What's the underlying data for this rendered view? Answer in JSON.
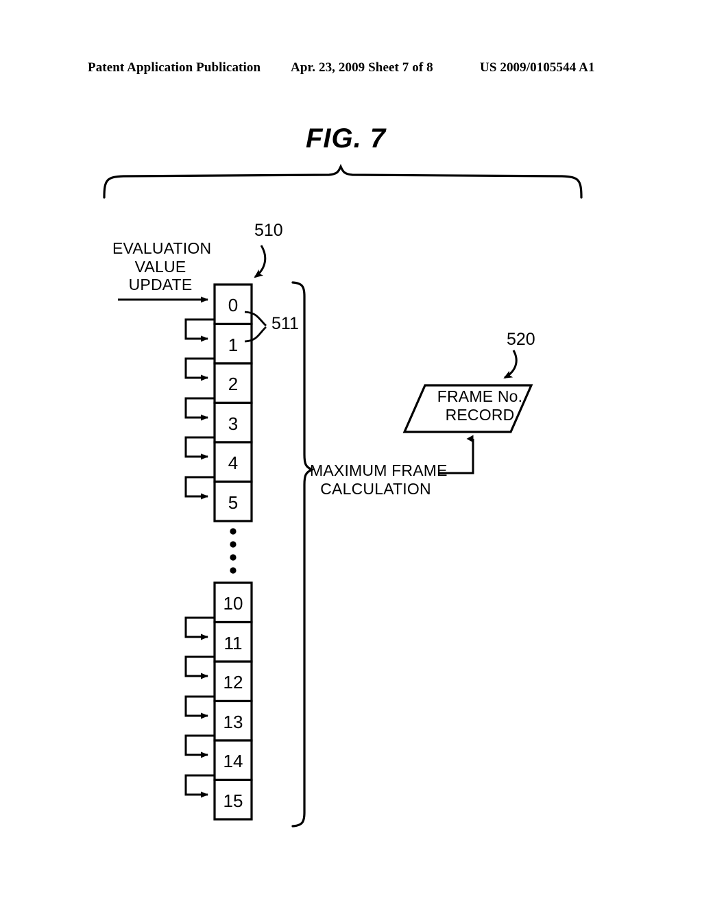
{
  "header": {
    "publication": "Patent Application Publication",
    "date_sheet": "Apr. 23, 2009  Sheet 7 of 8",
    "patent_number": "US 2009/0105544 A1"
  },
  "figure": {
    "title": "FIG. 7",
    "input_label": "EVALUATION\nVALUE\nUPDATE",
    "array_ref": "510",
    "cell_ref": "511",
    "record_ref": "520",
    "brace_label": "MAXIMUM FRAME\nCALCULATION",
    "record_label": "FRAME No.\nRECORD",
    "array_cells_upper": [
      "0",
      "1",
      "2",
      "3",
      "4",
      "5"
    ],
    "array_cells_lower": [
      "10",
      "11",
      "12",
      "13",
      "14",
      "15"
    ],
    "ellipsis_dots": 4
  },
  "colors": {
    "ink": "#000000",
    "paper": "#ffffff"
  }
}
